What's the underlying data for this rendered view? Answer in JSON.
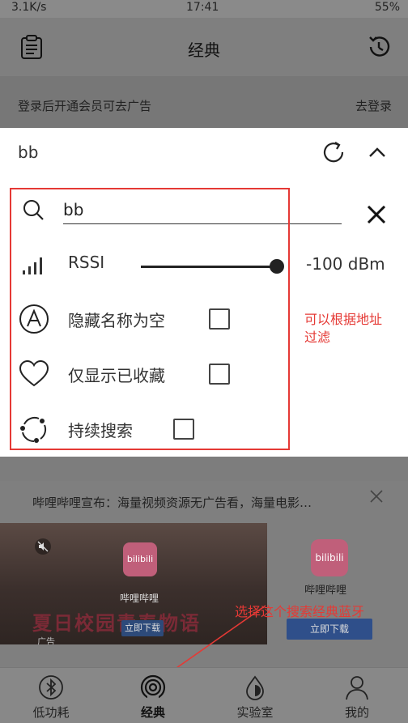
{
  "status_bar": {
    "network_speed": "3.1K/s",
    "time": "17:41",
    "battery": "55%"
  },
  "app_bar": {
    "title": "经典"
  },
  "login_banner": {
    "hint": "登录后开通会员可去广告",
    "action": "去登录"
  },
  "device": {
    "name": "bb"
  },
  "filter": {
    "search_value": "bb",
    "rssi_label": "RSSI",
    "rssi_value": "-100 dBm",
    "rssi_level": 1.0,
    "hide_empty_name_label": "隐藏名称为空",
    "hide_empty_name_checked": false,
    "show_favorites_label": "仅显示已收藏",
    "show_favorites_checked": false,
    "continuous_scan_label": "持续搜索",
    "continuous_scan_checked": false
  },
  "annotations": {
    "filter_note": "可以根据地址过滤",
    "bluetooth_note": "选择这个搜索经典蓝牙",
    "color": "#e53935"
  },
  "ad": {
    "text": "哔哩哔哩宣布：海量视频资源无广告看，海量电影…",
    "banner_headline": "夏日校园青春物语",
    "banner_app_name": "哔哩哔哩",
    "banner_download": "立即下载",
    "banner_tag": "广告",
    "logo_text": "bilibili",
    "right_app_name": "哔哩哔哩",
    "right_download": "立即下载"
  },
  "tabs": [
    {
      "label": "低功耗",
      "icon": "bluetooth-icon",
      "active": false
    },
    {
      "label": "经典",
      "icon": "signal-waves-icon",
      "active": true
    },
    {
      "label": "实验室",
      "icon": "drop-icon",
      "active": false
    },
    {
      "label": "我的",
      "icon": "person-icon",
      "active": false
    }
  ]
}
